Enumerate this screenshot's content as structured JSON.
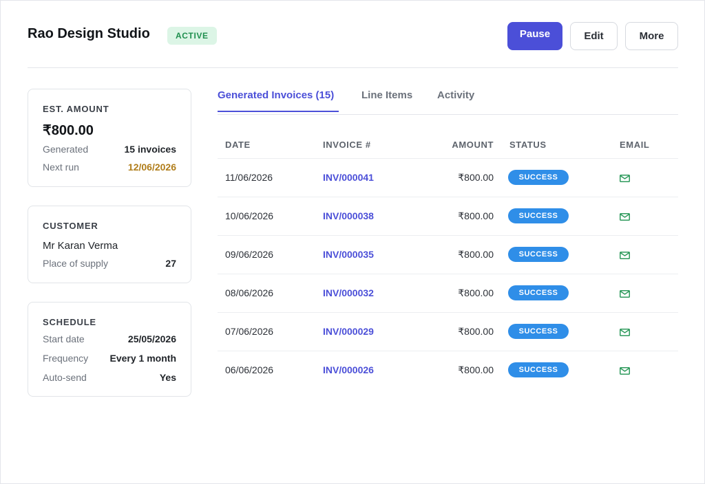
{
  "header": {
    "title": "Rao Design Studio",
    "status_badge": "ACTIVE",
    "pause_label": "Pause",
    "edit_label": "Edit",
    "more_label": "More"
  },
  "summary": {
    "heading": "EST. AMOUNT",
    "amount": "₹800.00",
    "generated_label": "Generated",
    "generated_value": "15 invoices",
    "next_run_label": "Next run",
    "next_run_value": "12/06/2026"
  },
  "customer": {
    "heading": "CUSTOMER",
    "name": "Mr Karan Verma",
    "place_label": "Place of supply",
    "place_value": "27"
  },
  "schedule": {
    "heading": "SCHEDULE",
    "start_label": "Start date",
    "start_value": "25/05/2026",
    "frequency_label": "Frequency",
    "frequency_value": "Every 1 month",
    "autosend_label": "Auto-send",
    "autosend_value": "Yes"
  },
  "tabs": [
    {
      "label": "Generated Invoices (15)",
      "active": true
    },
    {
      "label": "Line Items",
      "active": false
    },
    {
      "label": "Activity",
      "active": false
    }
  ],
  "table": {
    "columns": [
      "DATE",
      "INVOICE #",
      "AMOUNT",
      "STATUS",
      "EMAIL"
    ],
    "rows": [
      {
        "date": "11/06/2026",
        "invoice": "INV/000041",
        "amount": "₹800.00",
        "status": "SUCCESS",
        "email_icon": "mail-icon"
      },
      {
        "date": "10/06/2026",
        "invoice": "INV/000038",
        "amount": "₹800.00",
        "status": "SUCCESS",
        "email_icon": "mail-icon"
      },
      {
        "date": "09/06/2026",
        "invoice": "INV/000035",
        "amount": "₹800.00",
        "status": "SUCCESS",
        "email_icon": "mail-icon"
      },
      {
        "date": "08/06/2026",
        "invoice": "INV/000032",
        "amount": "₹800.00",
        "status": "SUCCESS",
        "email_icon": "mail-icon"
      },
      {
        "date": "07/06/2026",
        "invoice": "INV/000029",
        "amount": "₹800.00",
        "status": "SUCCESS",
        "email_icon": "mail-icon"
      },
      {
        "date": "06/06/2026",
        "invoice": "INV/000026",
        "amount": "₹800.00",
        "status": "SUCCESS",
        "email_icon": "mail-icon"
      }
    ]
  },
  "colors": {
    "accent": "#4b4fd8",
    "success_pill": "#2f8ee8",
    "active_badge_bg": "#dcf5e6",
    "active_badge_text": "#1f8f4e",
    "next_run_text": "#b07d1a",
    "mail_icon": "#2e9a5c"
  }
}
